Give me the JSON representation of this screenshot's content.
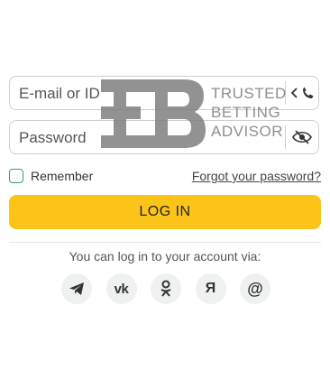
{
  "form": {
    "email_placeholder": "E-mail or ID",
    "password_placeholder": "Password",
    "remember_label": "Remember",
    "forgot_link": "Forgot your password?",
    "login_button": "LOG IN"
  },
  "social": {
    "caption": "You can log in to your account via:",
    "buttons": [
      {
        "name": "telegram-icon",
        "glyph": ""
      },
      {
        "name": "vk-icon",
        "glyph": "vk"
      },
      {
        "name": "odnoklassniki-icon",
        "glyph": ""
      },
      {
        "name": "yandex-icon",
        "glyph": "Я"
      },
      {
        "name": "email-at-icon",
        "glyph": "@"
      }
    ]
  },
  "watermark": {
    "line1": "TRUSTED",
    "line2": "BETTING",
    "line3": "ADVISOR"
  },
  "colors": {
    "accent": "#fcc419",
    "checkbox_border": "#2f9e6e",
    "field_border": "#cfcfcf"
  }
}
